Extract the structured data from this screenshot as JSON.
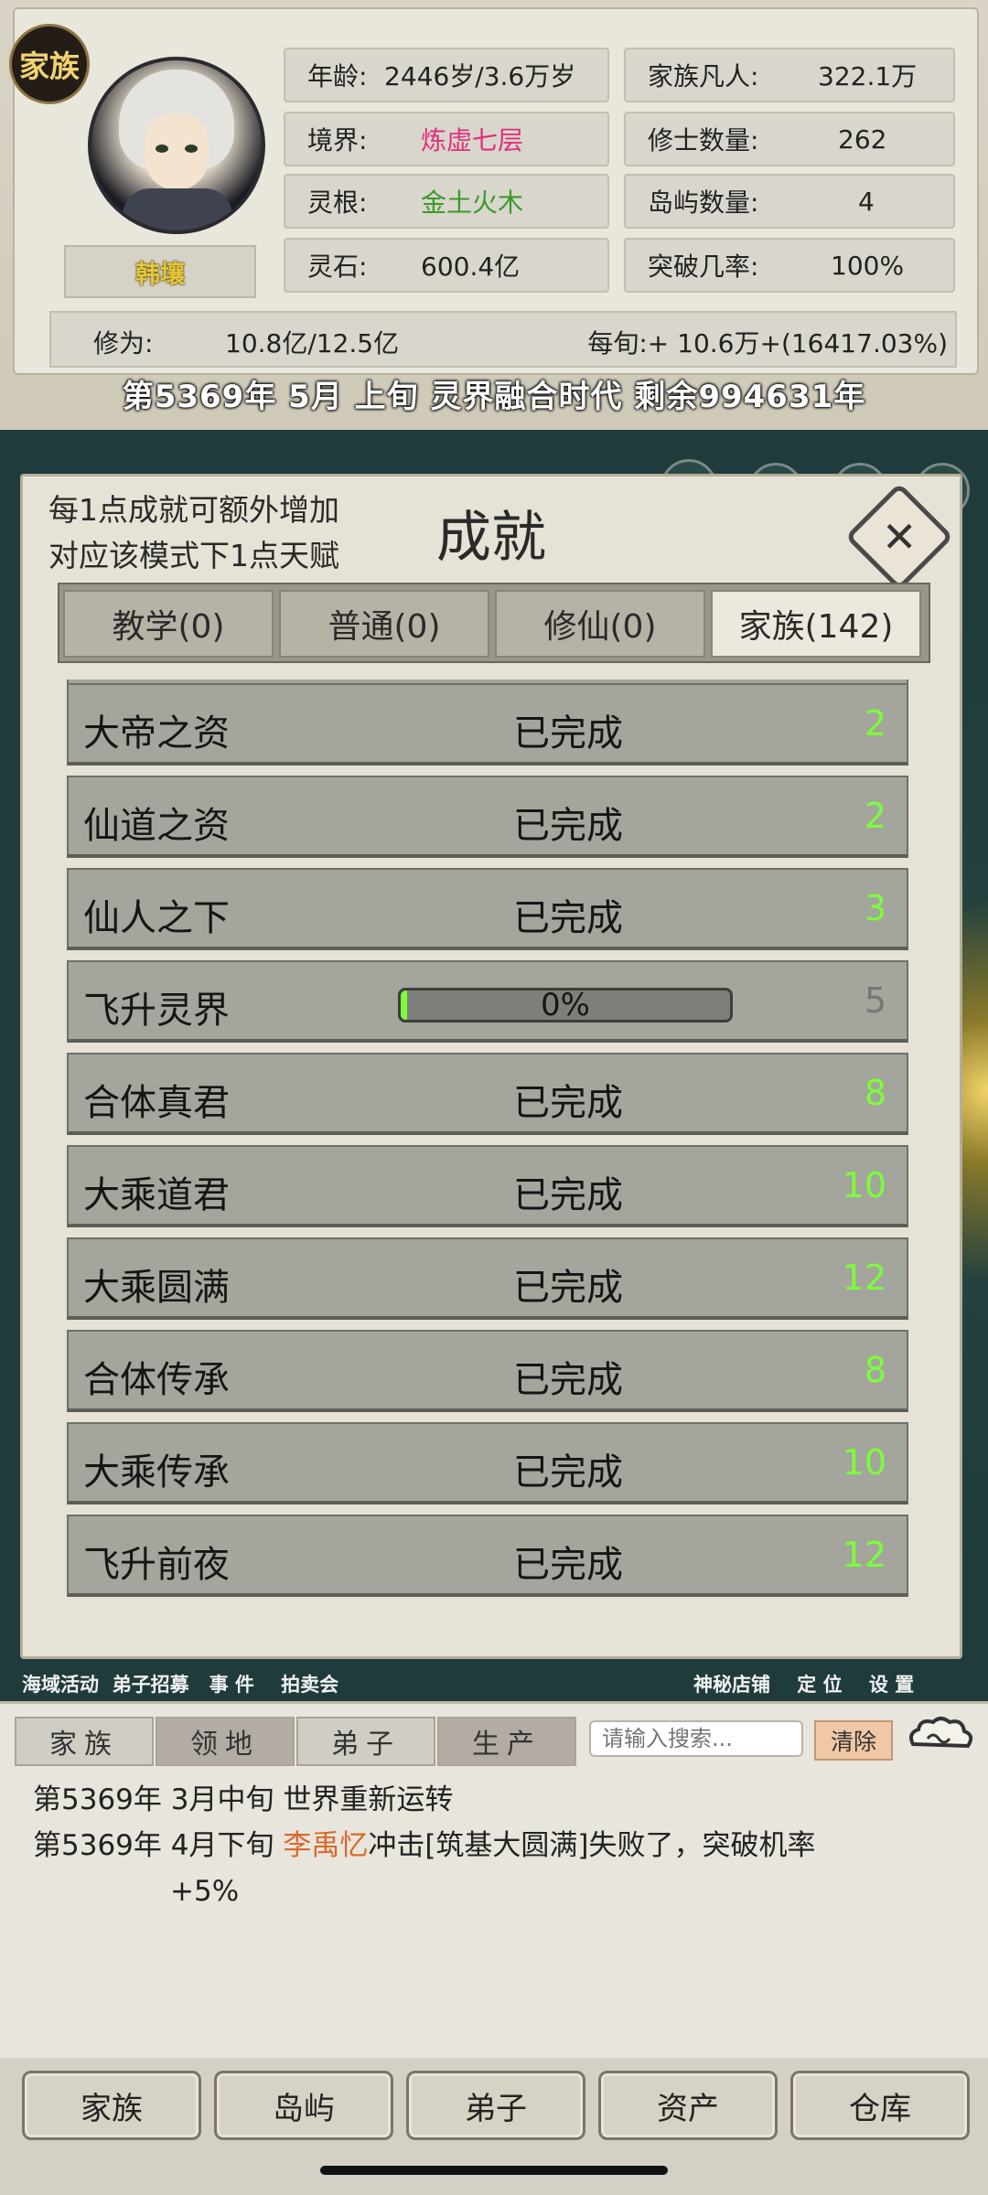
{
  "header": {
    "clan_badge": "家族",
    "player_name": "韩壤",
    "stats_left": [
      {
        "label": "年龄:",
        "value": "2446岁/3.6万岁",
        "color": "#222222"
      },
      {
        "label": "境界:",
        "value": "炼虚七层",
        "color": "#e0307a"
      },
      {
        "label": "灵根:",
        "value": "金土火木",
        "color": "#3a9a2a"
      },
      {
        "label": "灵石:",
        "value": "600.4亿",
        "color": "#222222"
      }
    ],
    "stats_right": [
      {
        "label": "家族凡人:",
        "value": "322.1万"
      },
      {
        "label": "修士数量:",
        "value": "262"
      },
      {
        "label": "岛屿数量:",
        "value": "4"
      },
      {
        "label": "突破几率:",
        "value": "100%"
      }
    ],
    "cultivation_label": "修为:",
    "cultivation_value": "10.8亿/12.5亿",
    "per_period": "每旬:+ 10.6万+(16417.03%)",
    "date_line": "第5369年 5月 上旬  灵界融合时代 剩余994631年"
  },
  "modal": {
    "title": "成就",
    "note_line1": "每1点成就可额外增加",
    "note_line2": "对应该模式下1点天赋",
    "tabs": [
      {
        "label": "教学(0)",
        "active": false
      },
      {
        "label": "普通(0)",
        "active": false
      },
      {
        "label": "修仙(0)",
        "active": false
      },
      {
        "label": "家族(142)",
        "active": true
      }
    ],
    "achievements": [
      {
        "name": "大帝之资",
        "status": "已完成",
        "points": "2",
        "done": true
      },
      {
        "name": "仙道之资",
        "status": "已完成",
        "points": "2",
        "done": true
      },
      {
        "name": "仙人之下",
        "status": "已完成",
        "points": "3",
        "done": true
      },
      {
        "name": "飞升灵界",
        "status": "0%",
        "progress": 0.0,
        "points": "5",
        "done": false
      },
      {
        "name": "合体真君",
        "status": "已完成",
        "points": "8",
        "done": true
      },
      {
        "name": "大乘道君",
        "status": "已完成",
        "points": "10",
        "done": true
      },
      {
        "name": "大乘圆满",
        "status": "已完成",
        "points": "12",
        "done": true
      },
      {
        "name": "合体传承",
        "status": "已完成",
        "points": "8",
        "done": true
      },
      {
        "name": "大乘传承",
        "status": "已完成",
        "points": "10",
        "done": true
      },
      {
        "name": "飞升前夜",
        "status": "已完成",
        "points": "12",
        "done": true
      }
    ]
  },
  "links": {
    "left": [
      "海域活动",
      "弟子招募",
      "事 件",
      "拍卖会"
    ],
    "right": [
      "神秘店铺",
      "定 位",
      "设 置"
    ]
  },
  "log": {
    "tabs": [
      "家族",
      "领地",
      "弟子",
      "生产"
    ],
    "search_placeholder": "请输入搜索...",
    "clear_label": "清除",
    "entries": [
      {
        "prefix": "第5369年 3月中旬 世界重新运转",
        "highlight": "",
        "suffix": "",
        "cont": ""
      },
      {
        "prefix": "第5369年 4月下旬 ",
        "highlight": "李禹忆",
        "suffix": "冲击[筑基大圆满]失败了，突破机率",
        "cont": "+5%"
      }
    ]
  },
  "bottom_nav": [
    "家族",
    "岛屿",
    "弟子",
    "资产",
    "仓库"
  ]
}
